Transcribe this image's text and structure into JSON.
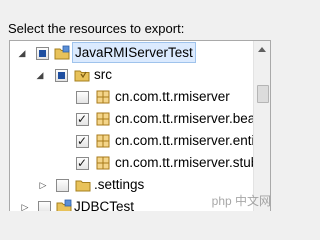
{
  "heading": "Select the resources to export:",
  "tree": {
    "project": {
      "label": "JavaRMIServerTest",
      "state": "partial",
      "expanded": true,
      "selected": true
    },
    "src": {
      "label": "src",
      "state": "partial",
      "expanded": true
    },
    "packages": [
      {
        "label": "cn.com.tt.rmiserver",
        "state": "unchecked"
      },
      {
        "label": "cn.com.tt.rmiserver.bean",
        "state": "checked"
      },
      {
        "label": "cn.com.tt.rmiserver.entity",
        "state": "checked"
      },
      {
        "label": "cn.com.tt.rmiserver.stub",
        "state": "checked"
      }
    ],
    "settings": {
      "label": ".settings",
      "state": "unchecked",
      "expanded": false
    },
    "next_project": {
      "label": "JDBCTest",
      "state": "unchecked",
      "expanded": false
    }
  },
  "watermark": "php 中文网"
}
